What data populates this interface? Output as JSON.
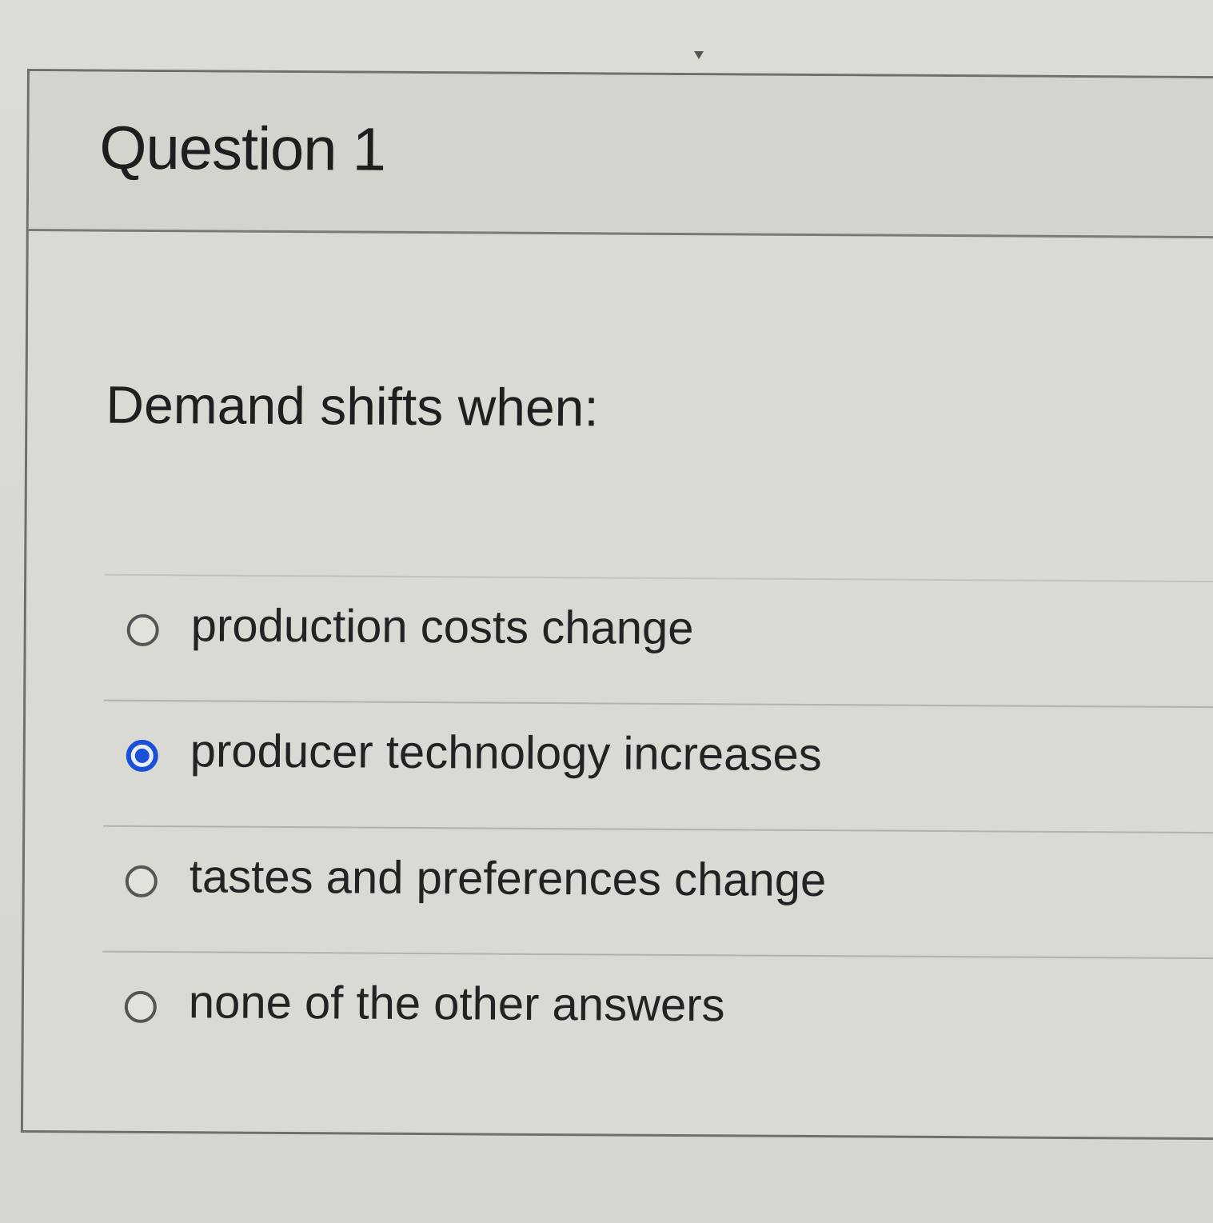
{
  "question": {
    "title": "Question 1",
    "prompt": "Demand shifts when:",
    "answers": [
      {
        "label": "production costs change",
        "selected": false
      },
      {
        "label": "producer technology increases",
        "selected": true
      },
      {
        "label": "tastes and preferences change",
        "selected": false
      },
      {
        "label": "none of the other answers",
        "selected": false
      }
    ]
  },
  "colors": {
    "selected_radio": "#1a4fd8",
    "background": "#d9d9d4",
    "text": "#1f1f1f"
  }
}
